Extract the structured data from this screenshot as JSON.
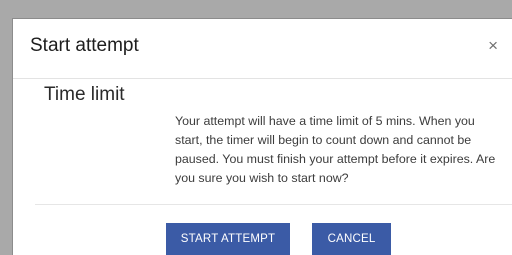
{
  "dialog": {
    "title": "Start attempt",
    "close_symbol": "×",
    "section_heading": "Time limit",
    "message": "Your attempt will have a time limit of 5 mins. When you start, the timer will begin to count down and cannot be paused. You must finish your attempt before it expires. Are you sure you wish to start now?",
    "buttons": {
      "start": "START ATTEMPT",
      "cancel": "CANCEL"
    }
  },
  "colors": {
    "overlay": "#a9a9a9",
    "primary_button": "#3b5ba6",
    "dialog_background": "#ffffff"
  }
}
